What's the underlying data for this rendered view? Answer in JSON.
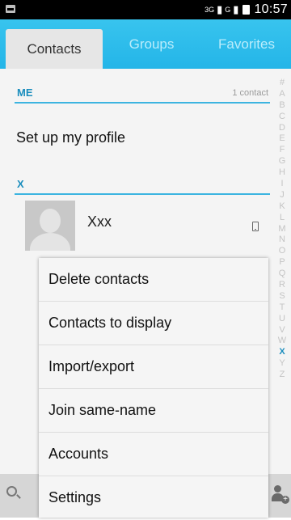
{
  "status_bar": {
    "signal_1_label": "3G",
    "signal_2_label": "G",
    "time": "10:57"
  },
  "tabs": [
    {
      "label": "Contacts",
      "active": true
    },
    {
      "label": "Groups",
      "active": false
    },
    {
      "label": "Favorites",
      "active": false
    }
  ],
  "me_section": {
    "title": "ME",
    "count": "1 contact",
    "profile_label": "Set up my profile"
  },
  "x_section": {
    "title": "X"
  },
  "contacts": [
    {
      "name": "Xxx",
      "icon": "phone-icon"
    }
  ],
  "alpha_index": [
    "#",
    "A",
    "B",
    "C",
    "D",
    "E",
    "F",
    "G",
    "H",
    "I",
    "J",
    "K",
    "L",
    "M",
    "N",
    "O",
    "P",
    "Q",
    "R",
    "S",
    "T",
    "U",
    "V",
    "W",
    "X",
    "Y",
    "Z"
  ],
  "alpha_index_active": "X",
  "menu": {
    "items": [
      "Delete contacts",
      "Contacts to display",
      "Import/export",
      "Join same-name",
      "Accounts",
      "Settings"
    ]
  },
  "colors": {
    "accent": "#1a8dbd",
    "tab_bar": "#2bb9ea",
    "menu_bg": "#f5f5f5"
  }
}
